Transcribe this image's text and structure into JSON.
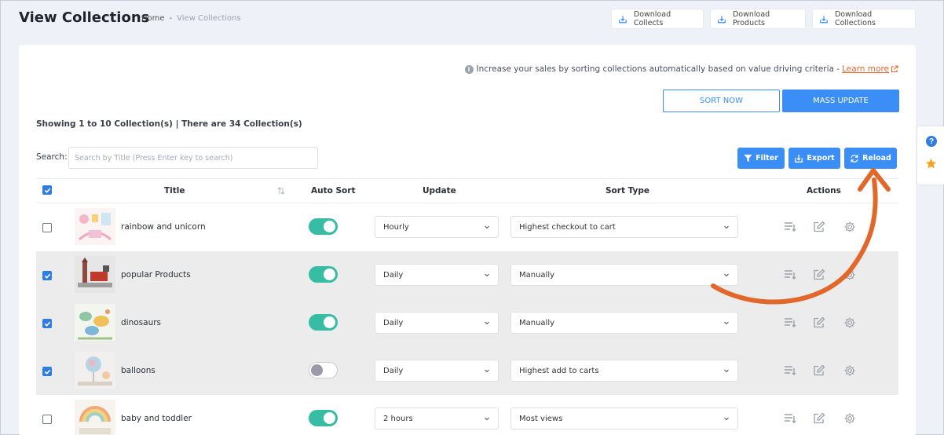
{
  "page_title": "View Collections",
  "breadcrumb": {
    "home": "Home",
    "separator": "-",
    "current": "View Collections"
  },
  "downloads": [
    "Download Collects",
    "Download Products",
    "Download Collections"
  ],
  "info": {
    "text": "Increase your sales by sorting collections automatically based on value driving criteria -",
    "link": "Learn more"
  },
  "buttons": {
    "sort_now": "SORT NOW",
    "mass_update": "MASS UPDATE",
    "filter": "Filter",
    "export": "Export",
    "reload": "Reload"
  },
  "showing": "Showing 1 to 10 Collection(s) | There are 34 Collection(s)",
  "search": {
    "label": "Search:",
    "placeholder": "Search by Title (Press Enter key to search)",
    "value": ""
  },
  "table": {
    "headers": {
      "title": "Title",
      "auto_sort": "Auto Sort",
      "update": "Update",
      "sort_type": "Sort Type",
      "actions": "Actions"
    },
    "rows": [
      {
        "name": "rainbow and unicorn",
        "checked": false,
        "auto_sort": true,
        "update": "Hourly",
        "sort_type": "Highest checkout to cart"
      },
      {
        "name": "popular Products",
        "checked": true,
        "auto_sort": true,
        "update": "Daily",
        "sort_type": "Manually"
      },
      {
        "name": "dinosaurs",
        "checked": true,
        "auto_sort": true,
        "update": "Daily",
        "sort_type": "Manually"
      },
      {
        "name": "balloons",
        "checked": true,
        "auto_sort": false,
        "update": "Daily",
        "sort_type": "Highest add to carts"
      },
      {
        "name": "baby and toddler",
        "checked": false,
        "auto_sort": true,
        "update": "2 hours",
        "sort_type": "Most views"
      }
    ]
  },
  "colors": {
    "primary": "#3b8ef5",
    "toggle_on": "#36bda3",
    "arrow": "#e2672a",
    "link": "#e8652a",
    "selected_row": "#ececec"
  }
}
